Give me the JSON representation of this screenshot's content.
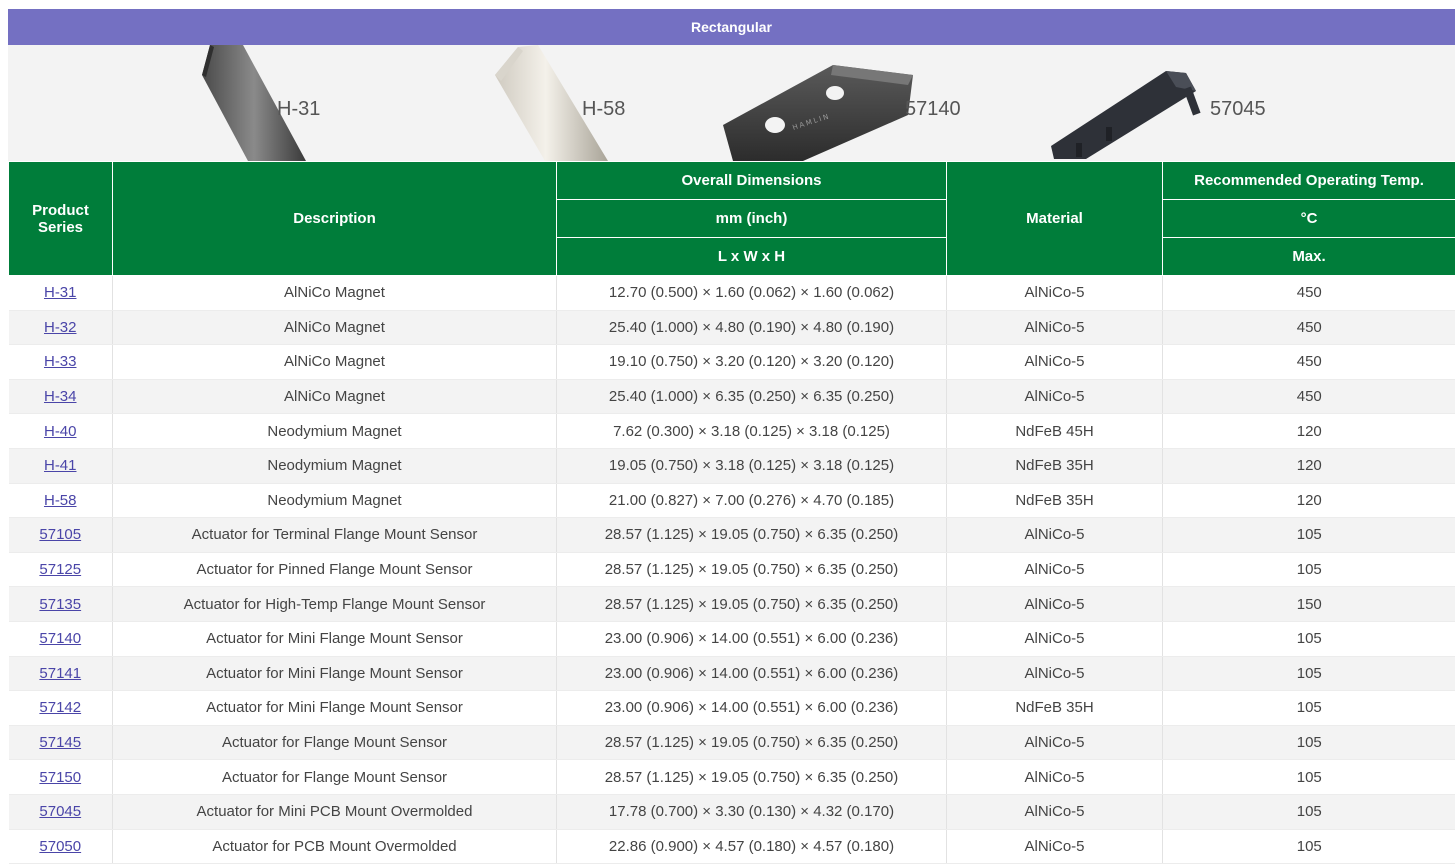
{
  "banner": {
    "title": "Rectangular"
  },
  "images": [
    {
      "label": "H-31"
    },
    {
      "label": "H-58"
    },
    {
      "label": "57140",
      "brand": "HAMLIN"
    },
    {
      "label": "57045"
    }
  ],
  "table": {
    "headers": {
      "series": "Product Series",
      "description": "Description",
      "dims_top": "Overall Dimensions",
      "dims_unit": "mm (inch)",
      "dims_axes": "L x W x H",
      "material": "Material",
      "temp_top": "Recommended Operating Temp.",
      "temp_unit": "°C",
      "temp_max": "Max."
    },
    "rows": [
      {
        "series": "H-31",
        "description": "AlNiCo Magnet",
        "dims": "12.70 (0.500) × 1.60 (0.062) × 1.60 (0.062)",
        "material": "AlNiCo-5",
        "temp": "450"
      },
      {
        "series": "H-32",
        "description": "AlNiCo Magnet",
        "dims": "25.40 (1.000) × 4.80 (0.190) × 4.80 (0.190)",
        "material": "AlNiCo-5",
        "temp": "450"
      },
      {
        "series": "H-33",
        "description": "AlNiCo Magnet",
        "dims": "19.10 (0.750) × 3.20 (0.120) × 3.20 (0.120)",
        "material": "AlNiCo-5",
        "temp": "450"
      },
      {
        "series": "H-34",
        "description": "AlNiCo Magnet",
        "dims": "25.40 (1.000) × 6.35 (0.250) × 6.35 (0.250)",
        "material": "AlNiCo-5",
        "temp": "450"
      },
      {
        "series": "H-40",
        "description": "Neodymium Magnet",
        "dims": "7.62 (0.300) × 3.18 (0.125) × 3.18 (0.125)",
        "material": "NdFeB 45H",
        "temp": "120"
      },
      {
        "series": "H-41",
        "description": "Neodymium Magnet",
        "dims": "19.05 (0.750) × 3.18 (0.125) × 3.18 (0.125)",
        "material": "NdFeB 35H",
        "temp": "120"
      },
      {
        "series": "H-58",
        "description": "Neodymium Magnet",
        "dims": "21.00 (0.827) × 7.00 (0.276) × 4.70 (0.185)",
        "material": "NdFeB 35H",
        "temp": "120"
      },
      {
        "series": "57105",
        "description": "Actuator for Terminal Flange Mount Sensor",
        "dims": "28.57 (1.125) × 19.05 (0.750) × 6.35 (0.250)",
        "material": "AlNiCo-5",
        "temp": "105"
      },
      {
        "series": "57125",
        "description": "Actuator for Pinned Flange Mount Sensor",
        "dims": "28.57 (1.125) × 19.05 (0.750) × 6.35 (0.250)",
        "material": "AlNiCo-5",
        "temp": "105"
      },
      {
        "series": "57135",
        "description": "Actuator for High-Temp Flange Mount Sensor",
        "dims": "28.57 (1.125) × 19.05 (0.750) × 6.35 (0.250)",
        "material": "AlNiCo-5",
        "temp": "150"
      },
      {
        "series": "57140",
        "description": "Actuator for Mini Flange Mount Sensor",
        "dims": "23.00 (0.906) × 14.00 (0.551) × 6.00 (0.236)",
        "material": "AlNiCo-5",
        "temp": "105"
      },
      {
        "series": "57141",
        "description": "Actuator for Mini Flange Mount Sensor",
        "dims": "23.00 (0.906) × 14.00 (0.551) × 6.00 (0.236)",
        "material": "AlNiCo-5",
        "temp": "105"
      },
      {
        "series": "57142",
        "description": "Actuator for Mini Flange Mount Sensor",
        "dims": "23.00 (0.906) × 14.00 (0.551) × 6.00 (0.236)",
        "material": "NdFeB 35H",
        "temp": "105"
      },
      {
        "series": "57145",
        "description": "Actuator for Flange Mount Sensor",
        "dims": "28.57 (1.125) × 19.05 (0.750) × 6.35 (0.250)",
        "material": "AlNiCo-5",
        "temp": "105"
      },
      {
        "series": "57150",
        "description": "Actuator for Flange Mount Sensor",
        "dims": "28.57 (1.125) × 19.05 (0.750) × 6.35 (0.250)",
        "material": "AlNiCo-5",
        "temp": "105"
      },
      {
        "series": "57045",
        "description": "Actuator for Mini PCB Mount Overmolded",
        "dims": "17.78 (0.700) × 3.30 (0.130) × 4.32 (0.170)",
        "material": "AlNiCo-5",
        "temp": "105"
      },
      {
        "series": "57050",
        "description": "Actuator for PCB Mount Overmolded",
        "dims": "22.86 (0.900) × 4.57 (0.180) × 4.57 (0.180)",
        "material": "AlNiCo-5",
        "temp": "105"
      }
    ]
  },
  "colors": {
    "banner": "#7470c2",
    "header": "#007d3a",
    "link": "#4a45a8",
    "row_alt": "#f3f3f3"
  }
}
